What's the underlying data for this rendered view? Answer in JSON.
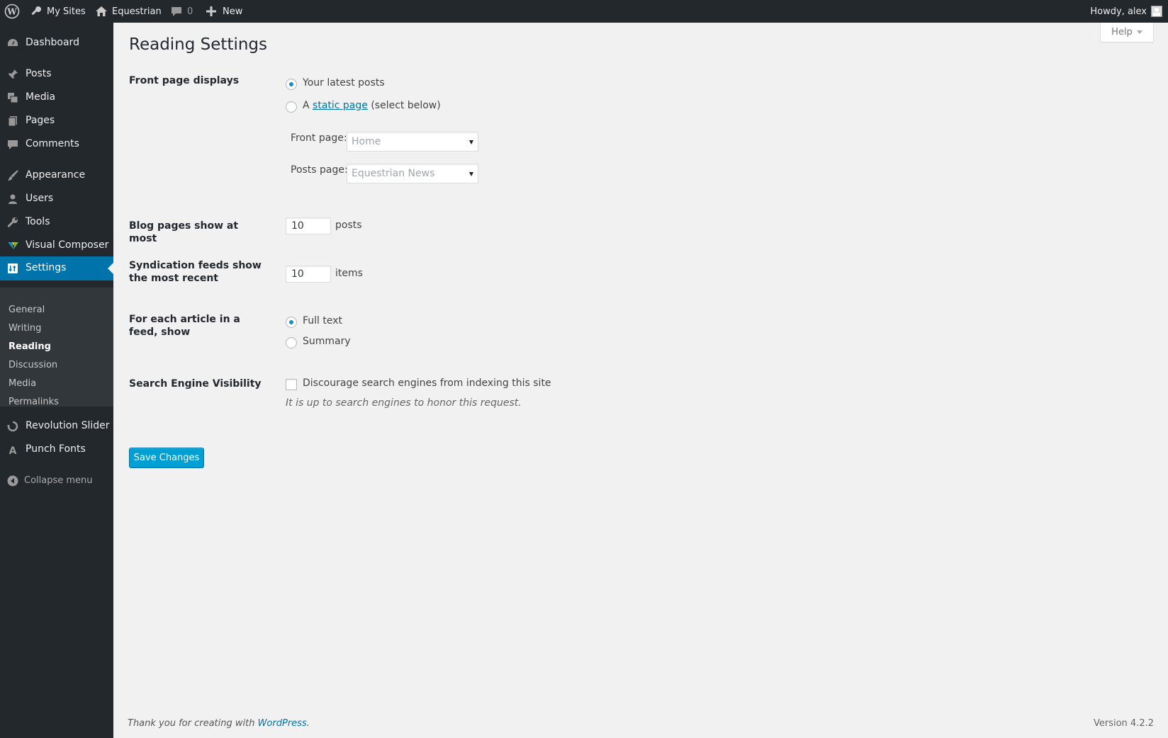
{
  "adminbar": {
    "my_sites": "My Sites",
    "site_name": "Equestrian",
    "comments_count": "0",
    "new_label": "New",
    "howdy": "Howdy, alex"
  },
  "sidebar": {
    "items": [
      {
        "label": "Dashboard",
        "icon": "dashboard-icon"
      },
      {
        "label": "Posts",
        "icon": "pushpin-icon"
      },
      {
        "label": "Media",
        "icon": "media-icon"
      },
      {
        "label": "Pages",
        "icon": "pages-icon"
      },
      {
        "label": "Comments",
        "icon": "comment-icon"
      },
      {
        "label": "Appearance",
        "icon": "paintbrush-icon"
      },
      {
        "label": "Users",
        "icon": "user-icon"
      },
      {
        "label": "Tools",
        "icon": "wrench-icon"
      },
      {
        "label": "Visual Composer",
        "icon": "visual-composer-icon"
      },
      {
        "label": "Settings",
        "icon": "settings-icon"
      },
      {
        "label": "Revolution Slider",
        "icon": "refresh-icon"
      },
      {
        "label": "Punch Fonts",
        "icon": "font-icon"
      }
    ],
    "submenu": [
      "General",
      "Writing",
      "Reading",
      "Discussion",
      "Media",
      "Permalinks"
    ],
    "collapse": "Collapse menu"
  },
  "main": {
    "help": "Help",
    "title": "Reading Settings",
    "front_page_displays": {
      "label": "Front page displays",
      "option_latest": "Your latest posts",
      "option_static_prefix": "A ",
      "option_static_link": "static page",
      "option_static_suffix": " (select below)",
      "front_page_label": "Front page:",
      "front_page_value": "Home",
      "posts_page_label": "Posts page:",
      "posts_page_value": "Equestrian News",
      "selected": "latest"
    },
    "blog_pages": {
      "label": "Blog pages show at most",
      "value": "10",
      "unit": "posts"
    },
    "syndication": {
      "label": "Syndication feeds show the most recent",
      "value": "10",
      "unit": "items"
    },
    "feed_article": {
      "label": "For each article in a feed, show",
      "option_full": "Full text",
      "option_summary": "Summary",
      "selected": "full"
    },
    "search_visibility": {
      "label": "Search Engine Visibility",
      "checkbox_label": "Discourage search engines from indexing this site",
      "checked": false,
      "description": "It is up to search engines to honor this request."
    },
    "save_label": "Save Changes"
  },
  "footer": {
    "thanks_prefix": "Thank you for creating with ",
    "thanks_link": "WordPress",
    "thanks_suffix": ".",
    "version": "Version 4.2.2"
  },
  "colors": {
    "adminbar_bg": "#23282d",
    "accent": "#0073aa",
    "button": "#00a0d2"
  }
}
